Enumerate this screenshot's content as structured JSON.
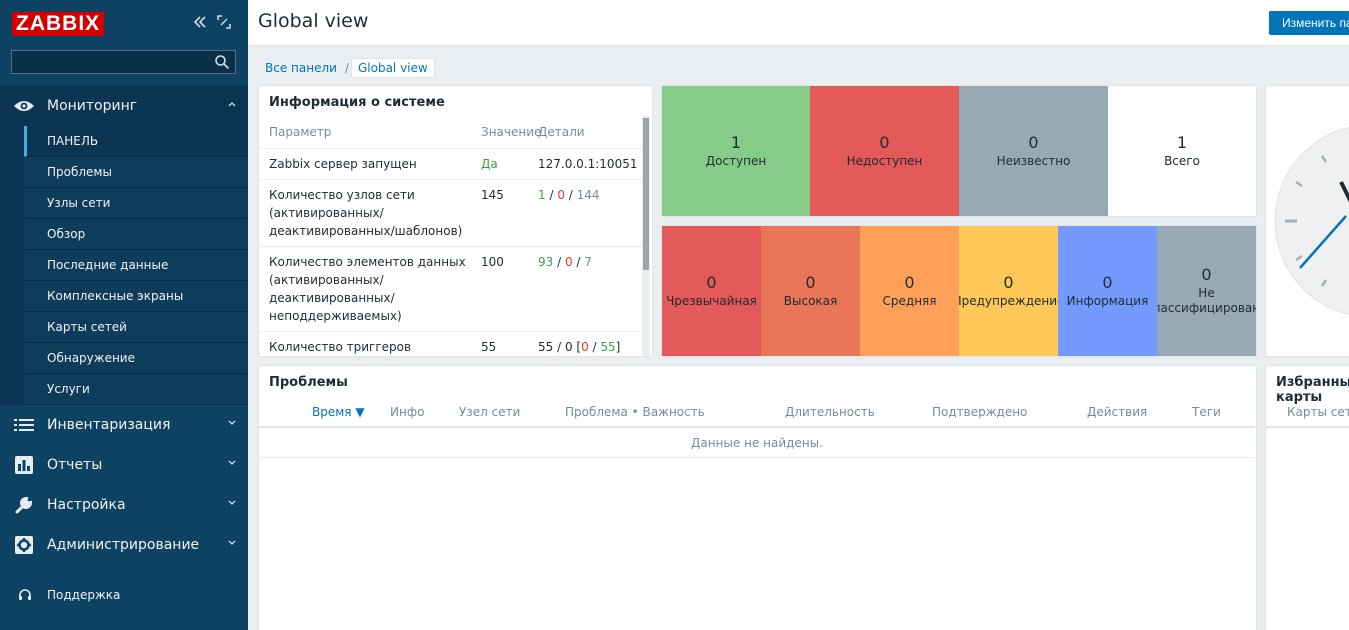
{
  "sidebar": {
    "logo": "ZABBIX",
    "collapse_icon": "double-chevron-left-icon",
    "kiosk_icon": "fullscreen-icon",
    "search": {
      "value": "",
      "placeholder": ""
    },
    "menu": [
      {
        "label": "Мониторинг",
        "icon": "eye-icon",
        "expanded": true,
        "items": [
          {
            "label": "ПАНЕЛЬ",
            "selected": true
          },
          {
            "label": "Проблемы"
          },
          {
            "label": "Узлы сети"
          },
          {
            "label": "Обзор"
          },
          {
            "label": "Последние данные"
          },
          {
            "label": "Комплексные экраны"
          },
          {
            "label": "Карты сетей"
          },
          {
            "label": "Обнаружение"
          },
          {
            "label": "Услуги"
          }
        ]
      },
      {
        "label": "Инвентаризация",
        "icon": "list-icon"
      },
      {
        "label": "Отчеты",
        "icon": "bar-chart-icon"
      },
      {
        "label": "Настройка",
        "icon": "wrench-icon"
      },
      {
        "label": "Администрирование",
        "icon": "gear-icon"
      }
    ],
    "support": "Поддержка"
  },
  "header": {
    "title": "Global view",
    "edit_button": "Изменить панель"
  },
  "breadcrumb": {
    "all": "Все панели",
    "separator": "/",
    "current": "Global view"
  },
  "system_info": {
    "title": "Информация о системе",
    "columns": [
      "Параметр",
      "Значение",
      "Детали"
    ],
    "rows": [
      {
        "param": "Zabbix сервер запущен",
        "value": "Да",
        "details": "127.0.0.1:10051"
      },
      {
        "param": "Количество узлов сети (активированных/ деактивированных/шаблонов)",
        "value": "145",
        "d1": "1",
        "d2": "0",
        "d3": "144",
        "sep": " / "
      },
      {
        "param": "Количество элементов данных (активированных/ деактивированных/ неподдерживаемых)",
        "value": "100",
        "d1": "93",
        "d2": "0",
        "d3": "7",
        "sep": " / "
      },
      {
        "param": "Количество триггеров",
        "value": "55",
        "details_prefix": "55 / 0 [",
        "d1": "0",
        "d2": "55",
        "details_suffix": "]",
        "sep": " / "
      }
    ]
  },
  "host_availability": [
    {
      "count": "1",
      "label": "Доступен",
      "color": "#86cc89"
    },
    {
      "count": "0",
      "label": "Недоступен",
      "color": "#e45959"
    },
    {
      "count": "0",
      "label": "Неизвестно",
      "color": "#97aab3"
    },
    {
      "count": "1",
      "label": "Всего",
      "color": "#ffffff"
    }
  ],
  "problems_by_severity": [
    {
      "count": "0",
      "label": "Чрезвычайная",
      "color": "#e45959"
    },
    {
      "count": "0",
      "label": "Высокая",
      "color": "#e97659"
    },
    {
      "count": "0",
      "label": "Средняя",
      "color": "#ffa059"
    },
    {
      "count": "0",
      "label": "Предупреждение",
      "color": "#ffc859"
    },
    {
      "count": "0",
      "label": "Информация",
      "color": "#7499ff"
    },
    {
      "count": "0",
      "label": "Не классифицировано",
      "label_lines": [
        "Не",
        "классифицировано"
      ],
      "color": "#97aab3"
    }
  ],
  "problems": {
    "title": "Проблемы",
    "columns": [
      "Время ▼",
      "Инфо",
      "Узел сети",
      "Проблема • Важность",
      "Длительность",
      "Подтверждено",
      "Действия",
      "Теги"
    ],
    "empty": "Данные не найдены."
  },
  "favorites": {
    "title": "Избранные карты",
    "column": "Карты сети"
  }
}
